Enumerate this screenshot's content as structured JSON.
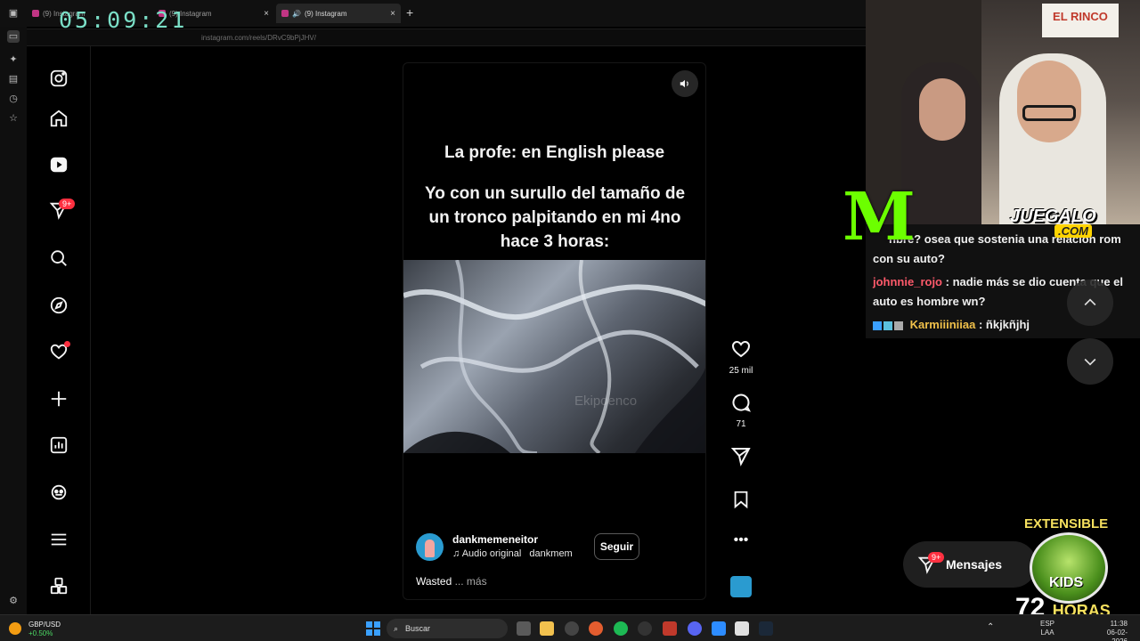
{
  "browser": {
    "clock": "05:09:21",
    "tabs": [
      {
        "label": "(9) Instagram",
        "active": false
      },
      {
        "label": "(9) Instagram",
        "active": false
      },
      {
        "label": "(9) Instagram",
        "active": true
      }
    ],
    "url": "instagram.com/reels/DRvC9bPjJHV/"
  },
  "nav": {
    "notifications_badge": "9+",
    "items": [
      "instagram-logo",
      "home-icon",
      "reels-icon",
      "direct-icon",
      "search-icon",
      "explore-icon",
      "heart-icon",
      "create-icon",
      "dashboard-icon",
      "threads-icon",
      "menu-icon",
      "apps-icon"
    ]
  },
  "reel": {
    "caption_line1": "La profe: en English please",
    "caption_line2": "Yo con un surullo del tamaño de un tronco palpitando en mi 4no hace 3 horas:",
    "watermark": "Ekipoenco",
    "username": "dankmemeneitor",
    "audio_label": "Audio original",
    "audio_author": "dankmem",
    "follow_label": "Seguir",
    "description": "Wasted",
    "more_label": "... más",
    "likes": "25 mil",
    "comments": "71"
  },
  "stream": {
    "sign_text": "EL RINCO",
    "juegalo": "JUEGALO",
    "juegalo_com": ".COM",
    "chat": [
      {
        "user": "",
        "text": "nbre? osea que sostenia una relación rom"
      },
      {
        "user": "",
        "text": "con su auto?"
      },
      {
        "user": "johnnie_rojo",
        "text": ": nadie más se dio cuenta que el"
      },
      {
        "user": "",
        "text": "auto es hombre wn?"
      },
      {
        "user": "Karmiiiniiaa",
        "text": ": ñkjkñjhj"
      }
    ],
    "messages_label": "Mensajes",
    "messages_badge": "9+",
    "ext_title": "EXTENSIBLE",
    "ext_kids": "KIDS",
    "ext_hours_num": "72",
    "ext_hours_word": "HORAS"
  },
  "taskbar": {
    "ticker_name": "GBP/USD",
    "ticker_change": "+0.50%",
    "search_label": "Buscar",
    "lang_top": "ESP",
    "lang_bottom": "LAA",
    "time": "11:38",
    "date": "06-02-2026"
  },
  "colors": {
    "accent": "#ff3040",
    "clock": "#7be0c8",
    "monster_green": "#6cff00"
  }
}
